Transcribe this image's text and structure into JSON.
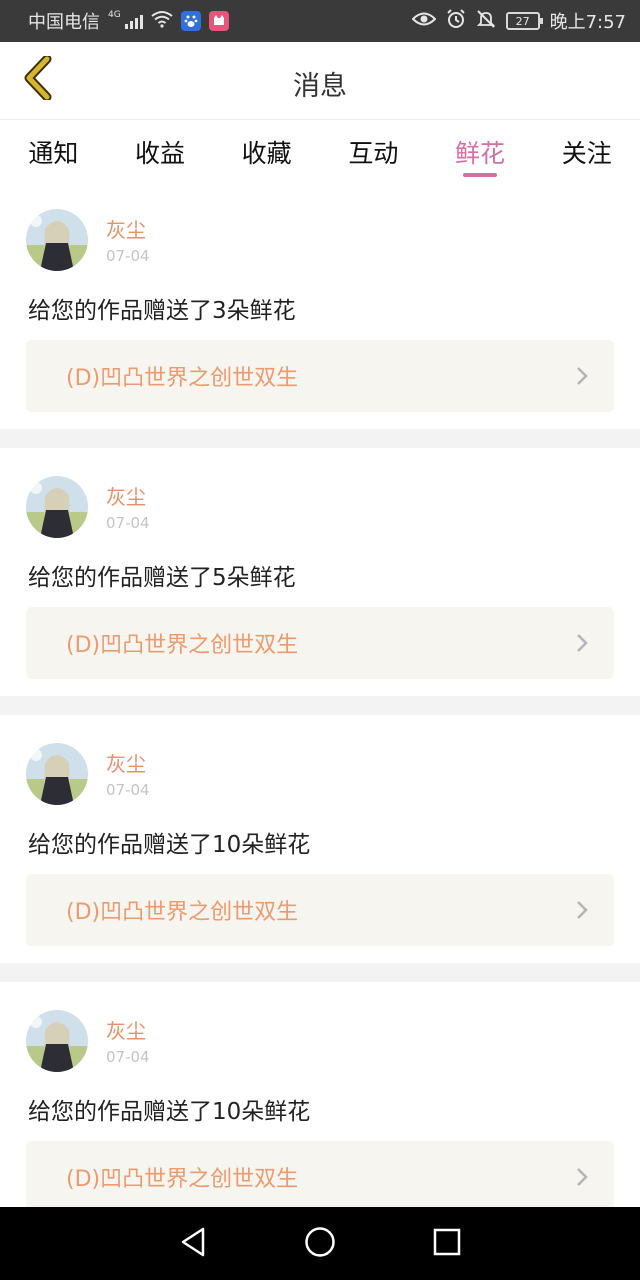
{
  "status_bar": {
    "carrier": "中国电信",
    "network": "4G",
    "battery": "27",
    "time": "晚上7:57"
  },
  "header": {
    "title": "消息"
  },
  "tabs": [
    {
      "label": "通知"
    },
    {
      "label": "收益"
    },
    {
      "label": "收藏"
    },
    {
      "label": "互动"
    },
    {
      "label": "鲜花"
    },
    {
      "label": "关注"
    }
  ],
  "active_tab": "鲜花",
  "messages": [
    {
      "user": "灰尘",
      "date": "07-04",
      "text": "给您的作品赠送了3朵鲜花",
      "work": "(D)凹凸世界之创世双生"
    },
    {
      "user": "灰尘",
      "date": "07-04",
      "text": "给您的作品赠送了5朵鲜花",
      "work": "(D)凹凸世界之创世双生"
    },
    {
      "user": "灰尘",
      "date": "07-04",
      "text": "给您的作品赠送了10朵鲜花",
      "work": "(D)凹凸世界之创世双生"
    },
    {
      "user": "灰尘",
      "date": "07-04",
      "text": "给您的作品赠送了10朵鲜花",
      "work": "(D)凹凸世界之创世双生"
    }
  ],
  "colors": {
    "accent": "#d96ea6",
    "username": "#e8916a",
    "work_title": "#ee9a6e",
    "back_arrow": "#c9a227"
  },
  "icons": {
    "back": "chevron-left-icon",
    "work_arrow": "chevron-right-icon",
    "nav": [
      "back-triangle-icon",
      "home-circle-icon",
      "recents-square-icon"
    ]
  }
}
